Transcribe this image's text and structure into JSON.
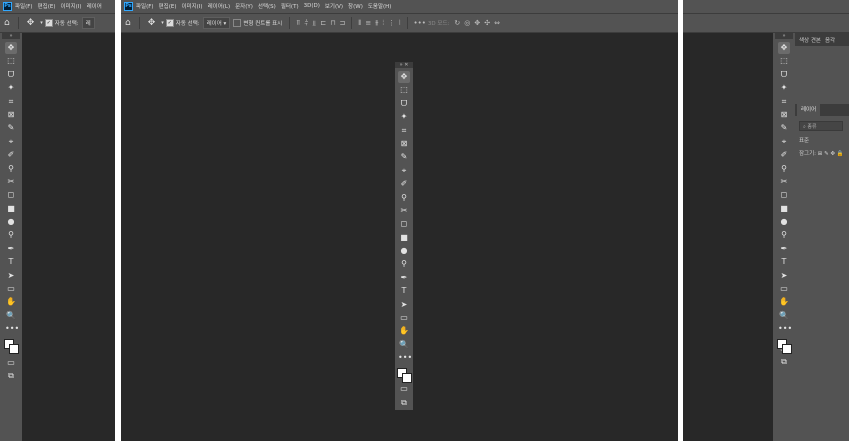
{
  "window_left": {
    "menu": [
      "파일(F)",
      "편집(E)",
      "이미지(I)",
      "레이어"
    ],
    "options": {
      "auto_select_label": "자동 선택:",
      "layer_select": "레"
    },
    "tools": [
      "✥",
      "⬚",
      "ᗜ",
      "✦",
      "⌗",
      "⊠",
      "✎",
      "⌖",
      "✐",
      "⚲",
      "✂",
      "◻",
      "■",
      "●",
      "⚲",
      "✒",
      "T",
      "➤",
      "▭",
      "✋",
      "🔍",
      "•••"
    ]
  },
  "window_center": {
    "menu": [
      "파일(F)",
      "편집(E)",
      "이미지(I)",
      "레이어(L)",
      "문자(Y)",
      "선택(S)",
      "필터(T)",
      "3D(D)",
      "보기(V)",
      "창(W)",
      "도움말(H)"
    ],
    "options": {
      "auto_select_label": "자동 선택:",
      "layer_select": "레이어",
      "transform_label": "변형 컨트롤 표시",
      "mode_3d": "3D 모드:"
    },
    "tools": [
      "✥",
      "⬚",
      "ᗜ",
      "✦",
      "⌗",
      "⊠",
      "✎",
      "⌖",
      "✐",
      "⚲",
      "✂",
      "◻",
      "■",
      "●",
      "⚲",
      "✒",
      "T",
      "➤",
      "▭",
      "✋",
      "🔍",
      "•••"
    ]
  },
  "window_right": {
    "panel_tabs": [
      "색상 견본",
      "음각"
    ],
    "layers_tab": "레이어",
    "search_placeholder": "종류",
    "mode": "표준",
    "lock_label": "잠그기:",
    "tools": [
      "✥",
      "⬚",
      "ᗜ",
      "✦",
      "⌗",
      "⊠",
      "✎",
      "⌖",
      "✐",
      "⚲",
      "✂",
      "◻",
      "■",
      "●",
      "⚲",
      "✒",
      "T",
      "➤",
      "▭",
      "✋",
      "🔍",
      "•••"
    ]
  }
}
